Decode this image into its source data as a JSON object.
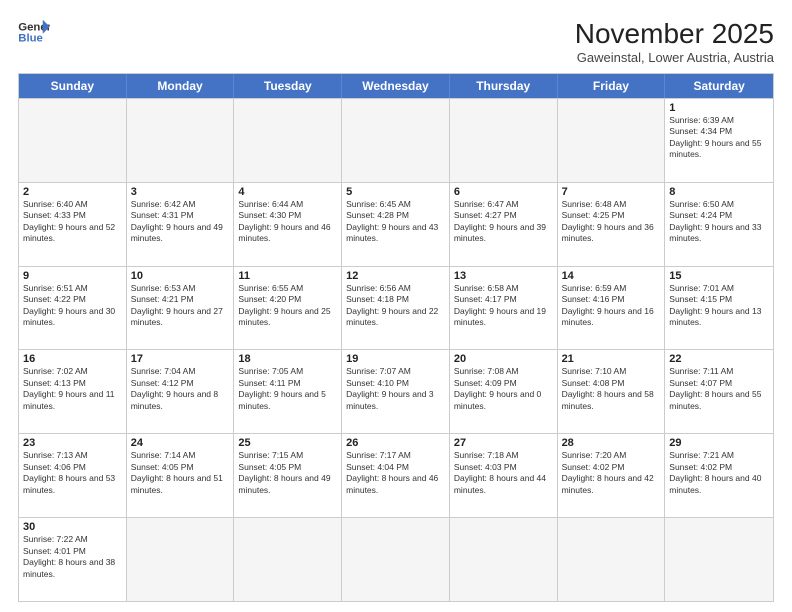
{
  "header": {
    "logo_general": "General",
    "logo_blue": "Blue",
    "month_title": "November 2025",
    "subtitle": "Gaweinstal, Lower Austria, Austria"
  },
  "days_of_week": [
    "Sunday",
    "Monday",
    "Tuesday",
    "Wednesday",
    "Thursday",
    "Friday",
    "Saturday"
  ],
  "weeks": [
    [
      {
        "day": "",
        "info": ""
      },
      {
        "day": "",
        "info": ""
      },
      {
        "day": "",
        "info": ""
      },
      {
        "day": "",
        "info": ""
      },
      {
        "day": "",
        "info": ""
      },
      {
        "day": "",
        "info": ""
      },
      {
        "day": "1",
        "info": "Sunrise: 6:39 AM\nSunset: 4:34 PM\nDaylight: 9 hours and 55 minutes."
      }
    ],
    [
      {
        "day": "2",
        "info": "Sunrise: 6:40 AM\nSunset: 4:33 PM\nDaylight: 9 hours and 52 minutes."
      },
      {
        "day": "3",
        "info": "Sunrise: 6:42 AM\nSunset: 4:31 PM\nDaylight: 9 hours and 49 minutes."
      },
      {
        "day": "4",
        "info": "Sunrise: 6:44 AM\nSunset: 4:30 PM\nDaylight: 9 hours and 46 minutes."
      },
      {
        "day": "5",
        "info": "Sunrise: 6:45 AM\nSunset: 4:28 PM\nDaylight: 9 hours and 43 minutes."
      },
      {
        "day": "6",
        "info": "Sunrise: 6:47 AM\nSunset: 4:27 PM\nDaylight: 9 hours and 39 minutes."
      },
      {
        "day": "7",
        "info": "Sunrise: 6:48 AM\nSunset: 4:25 PM\nDaylight: 9 hours and 36 minutes."
      },
      {
        "day": "8",
        "info": "Sunrise: 6:50 AM\nSunset: 4:24 PM\nDaylight: 9 hours and 33 minutes."
      }
    ],
    [
      {
        "day": "9",
        "info": "Sunrise: 6:51 AM\nSunset: 4:22 PM\nDaylight: 9 hours and 30 minutes."
      },
      {
        "day": "10",
        "info": "Sunrise: 6:53 AM\nSunset: 4:21 PM\nDaylight: 9 hours and 27 minutes."
      },
      {
        "day": "11",
        "info": "Sunrise: 6:55 AM\nSunset: 4:20 PM\nDaylight: 9 hours and 25 minutes."
      },
      {
        "day": "12",
        "info": "Sunrise: 6:56 AM\nSunset: 4:18 PM\nDaylight: 9 hours and 22 minutes."
      },
      {
        "day": "13",
        "info": "Sunrise: 6:58 AM\nSunset: 4:17 PM\nDaylight: 9 hours and 19 minutes."
      },
      {
        "day": "14",
        "info": "Sunrise: 6:59 AM\nSunset: 4:16 PM\nDaylight: 9 hours and 16 minutes."
      },
      {
        "day": "15",
        "info": "Sunrise: 7:01 AM\nSunset: 4:15 PM\nDaylight: 9 hours and 13 minutes."
      }
    ],
    [
      {
        "day": "16",
        "info": "Sunrise: 7:02 AM\nSunset: 4:13 PM\nDaylight: 9 hours and 11 minutes."
      },
      {
        "day": "17",
        "info": "Sunrise: 7:04 AM\nSunset: 4:12 PM\nDaylight: 9 hours and 8 minutes."
      },
      {
        "day": "18",
        "info": "Sunrise: 7:05 AM\nSunset: 4:11 PM\nDaylight: 9 hours and 5 minutes."
      },
      {
        "day": "19",
        "info": "Sunrise: 7:07 AM\nSunset: 4:10 PM\nDaylight: 9 hours and 3 minutes."
      },
      {
        "day": "20",
        "info": "Sunrise: 7:08 AM\nSunset: 4:09 PM\nDaylight: 9 hours and 0 minutes."
      },
      {
        "day": "21",
        "info": "Sunrise: 7:10 AM\nSunset: 4:08 PM\nDaylight: 8 hours and 58 minutes."
      },
      {
        "day": "22",
        "info": "Sunrise: 7:11 AM\nSunset: 4:07 PM\nDaylight: 8 hours and 55 minutes."
      }
    ],
    [
      {
        "day": "23",
        "info": "Sunrise: 7:13 AM\nSunset: 4:06 PM\nDaylight: 8 hours and 53 minutes."
      },
      {
        "day": "24",
        "info": "Sunrise: 7:14 AM\nSunset: 4:05 PM\nDaylight: 8 hours and 51 minutes."
      },
      {
        "day": "25",
        "info": "Sunrise: 7:15 AM\nSunset: 4:05 PM\nDaylight: 8 hours and 49 minutes."
      },
      {
        "day": "26",
        "info": "Sunrise: 7:17 AM\nSunset: 4:04 PM\nDaylight: 8 hours and 46 minutes."
      },
      {
        "day": "27",
        "info": "Sunrise: 7:18 AM\nSunset: 4:03 PM\nDaylight: 8 hours and 44 minutes."
      },
      {
        "day": "28",
        "info": "Sunrise: 7:20 AM\nSunset: 4:02 PM\nDaylight: 8 hours and 42 minutes."
      },
      {
        "day": "29",
        "info": "Sunrise: 7:21 AM\nSunset: 4:02 PM\nDaylight: 8 hours and 40 minutes."
      }
    ],
    [
      {
        "day": "30",
        "info": "Sunrise: 7:22 AM\nSunset: 4:01 PM\nDaylight: 8 hours and 38 minutes."
      },
      {
        "day": "",
        "info": ""
      },
      {
        "day": "",
        "info": ""
      },
      {
        "day": "",
        "info": ""
      },
      {
        "day": "",
        "info": ""
      },
      {
        "day": "",
        "info": ""
      },
      {
        "day": "",
        "info": ""
      }
    ]
  ]
}
